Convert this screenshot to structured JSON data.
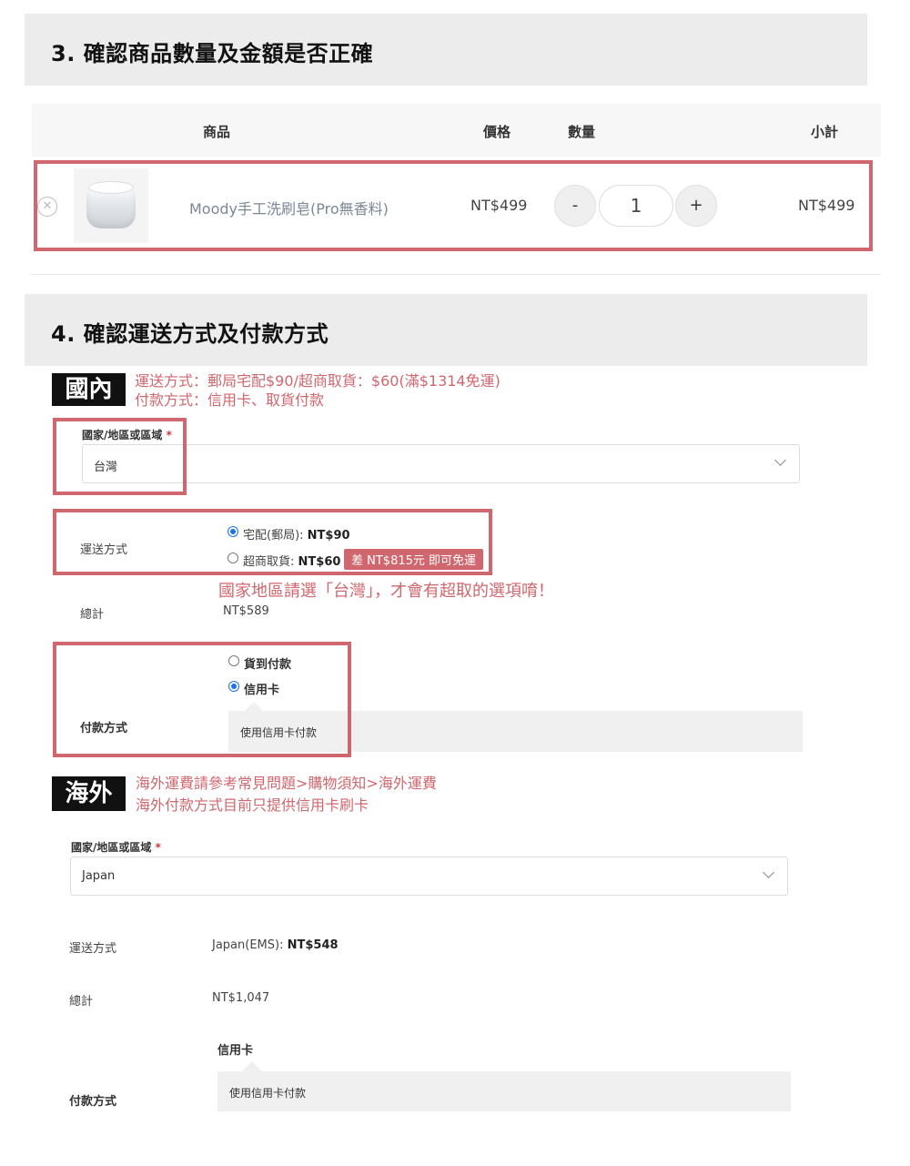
{
  "section3": {
    "title": "3. 確認商品數量及金額是否正確"
  },
  "cart": {
    "headers": {
      "product": "商品",
      "price": "價格",
      "qty": "數量",
      "subtotal": "小計"
    },
    "item": {
      "remove_glyph": "✕",
      "name": "Moody手工洗刷皂(Pro無香料)",
      "price": "NT$499",
      "qty": "1",
      "minus": "-",
      "plus": "+",
      "subtotal": "NT$499"
    }
  },
  "section4": {
    "title": "4. 確認運送方式及付款方式"
  },
  "domestic": {
    "tag": "國內",
    "note_line1": "運送方式：郵局宅配$90/超商取貨：$60(滿$1314免運)",
    "note_line2": "付款方式：信用卡、取貨付款",
    "country_label": "國家/地區或區域",
    "required_mark": "*",
    "country_value": "台灣",
    "shipping_label": "運送方式",
    "ship_option1": "宅配(郵局):",
    "ship_option1_price": "NT$90",
    "ship_option2": "超商取貨:",
    "ship_option2_price": "NT$60",
    "ship_badge": "差 NT$815元 即可免運",
    "hint": "國家地區請選「台灣」，才會有超取的選項唷！",
    "total_label": "總計",
    "total_value": "NT$589",
    "payment_label": "付款方式",
    "pay_option1": "貨到付款",
    "pay_option2": "信用卡",
    "pay_desc": "使用信用卡付款"
  },
  "overseas": {
    "tag": "海外",
    "note_line1": "海外運費請參考常見問題>購物須知>海外運費",
    "note_line2": "海外付款方式目前只提供信用卡刷卡",
    "country_label": "國家/地區或區域",
    "required_mark": "*",
    "country_value": "Japan",
    "shipping_label": "運送方式",
    "ship_option": "Japan(EMS):",
    "ship_price": "NT$548",
    "total_label": "總計",
    "total_value": "NT$1,047",
    "payment_label": "付款方式",
    "pay_option": "信用卡",
    "pay_desc": "使用信用卡付款"
  },
  "colors": {
    "accent_red": "#d0676e",
    "radio_blue": "#1a73e8",
    "section_bg": "#ececec"
  }
}
